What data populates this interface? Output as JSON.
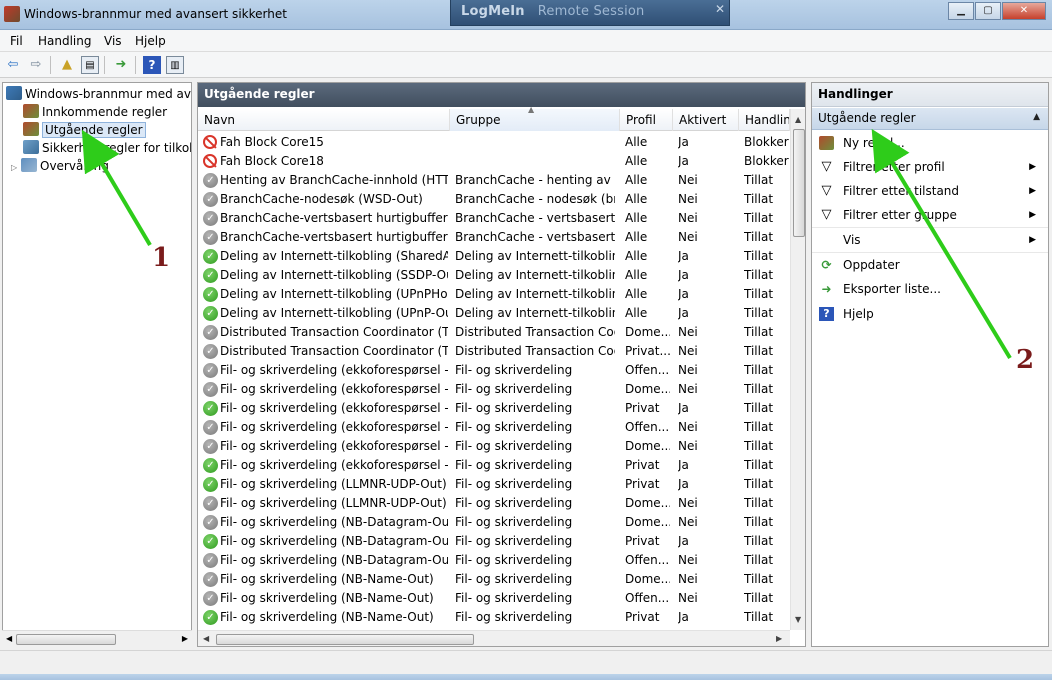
{
  "window": {
    "title": "Windows-brannmur med avansert sikkerhet",
    "remote_label_bold": "LogMeIn",
    "remote_label": "Remote Session",
    "remote_close": "✕",
    "minimize": "▁",
    "maximize": "▢",
    "close": "✕"
  },
  "menu": [
    "Fil",
    "Handling",
    "Vis",
    "Hjelp"
  ],
  "toolbar_icons": [
    "back-arrow-icon",
    "forward-arrow-icon",
    "up-folder-icon",
    "show-hide-tree-icon",
    "export-list-icon",
    "help-icon",
    "show-hide-action-pane-icon"
  ],
  "tree": {
    "root": "Windows-brannmur med avansert sikkerhet",
    "items": [
      {
        "label": "Innkommende regler"
      },
      {
        "label": "Utgående regler"
      },
      {
        "label": "Sikkerhetsregler for tilkoblinger"
      },
      {
        "label": "Overvåking"
      }
    ]
  },
  "center": {
    "title": "Utgående regler",
    "columns": [
      "Navn",
      "Gruppe",
      "Profil",
      "Aktivert",
      "Handling"
    ],
    "rows": [
      {
        "icon": "block",
        "name": "Fah Block Core15",
        "group": "",
        "profile": "Alle",
        "active": "Ja",
        "action": "Blokker"
      },
      {
        "icon": "block",
        "name": "Fah Block Core18",
        "group": "",
        "profile": "Alle",
        "active": "Ja",
        "action": "Blokker"
      },
      {
        "icon": "disabled",
        "name": "Henting av BranchCache-innhold (HTTP...",
        "group": "BranchCache - henting av i...",
        "profile": "Alle",
        "active": "Nei",
        "action": "Tillat"
      },
      {
        "icon": "disabled",
        "name": "BranchCache-nodesøk (WSD-Out)",
        "group": "BranchCache - nodesøk (br...",
        "profile": "Alle",
        "active": "Nei",
        "action": "Tillat"
      },
      {
        "icon": "disabled",
        "name": "BranchCache-vertsbasert hurtigbufferklie...",
        "group": "BranchCache - vertsbasert h...",
        "profile": "Alle",
        "active": "Nei",
        "action": "Tillat"
      },
      {
        "icon": "disabled",
        "name": "BranchCache-vertsbasert hurtigbufferser...",
        "group": "BranchCache - vertsbasert h...",
        "profile": "Alle",
        "active": "Nei",
        "action": "Tillat"
      },
      {
        "icon": "allow",
        "name": "Deling av Internett-tilkobling (SharedAcc...",
        "group": "Deling av Internett-tilkobling",
        "profile": "Alle",
        "active": "Ja",
        "action": "Tillat"
      },
      {
        "icon": "allow",
        "name": "Deling av Internett-tilkobling (SSDP-Out)",
        "group": "Deling av Internett-tilkobling",
        "profile": "Alle",
        "active": "Ja",
        "action": "Tillat"
      },
      {
        "icon": "allow",
        "name": "Deling av Internett-tilkobling (UPnPHost...",
        "group": "Deling av Internett-tilkobling",
        "profile": "Alle",
        "active": "Ja",
        "action": "Tillat"
      },
      {
        "icon": "allow",
        "name": "Deling av Internett-tilkobling (UPnP-Out)",
        "group": "Deling av Internett-tilkobling",
        "profile": "Alle",
        "active": "Ja",
        "action": "Tillat"
      },
      {
        "icon": "disabled",
        "name": "Distributed Transaction Coordinator (TC...",
        "group": "Distributed Transaction Coo...",
        "profile": "Dome...",
        "active": "Nei",
        "action": "Tillat"
      },
      {
        "icon": "disabled",
        "name": "Distributed Transaction Coordinator (TC...",
        "group": "Distributed Transaction Coo...",
        "profile": "Privat...",
        "active": "Nei",
        "action": "Tillat"
      },
      {
        "icon": "disabled",
        "name": "Fil- og skriverdeling (ekkoforespørsel - IC...",
        "group": "Fil- og skriverdeling",
        "profile": "Offen...",
        "active": "Nei",
        "action": "Tillat"
      },
      {
        "icon": "disabled",
        "name": "Fil- og skriverdeling (ekkoforespørsel - IC...",
        "group": "Fil- og skriverdeling",
        "profile": "Dome...",
        "active": "Nei",
        "action": "Tillat"
      },
      {
        "icon": "allow",
        "name": "Fil- og skriverdeling (ekkoforespørsel - IC...",
        "group": "Fil- og skriverdeling",
        "profile": "Privat",
        "active": "Ja",
        "action": "Tillat"
      },
      {
        "icon": "disabled",
        "name": "Fil- og skriverdeling (ekkoforespørsel - IC...",
        "group": "Fil- og skriverdeling",
        "profile": "Offen...",
        "active": "Nei",
        "action": "Tillat"
      },
      {
        "icon": "disabled",
        "name": "Fil- og skriverdeling (ekkoforespørsel - IC...",
        "group": "Fil- og skriverdeling",
        "profile": "Dome...",
        "active": "Nei",
        "action": "Tillat"
      },
      {
        "icon": "allow",
        "name": "Fil- og skriverdeling (ekkoforespørsel - IC...",
        "group": "Fil- og skriverdeling",
        "profile": "Privat",
        "active": "Ja",
        "action": "Tillat"
      },
      {
        "icon": "allow",
        "name": "Fil- og skriverdeling (LLMNR-UDP-Out)",
        "group": "Fil- og skriverdeling",
        "profile": "Privat",
        "active": "Ja",
        "action": "Tillat"
      },
      {
        "icon": "disabled",
        "name": "Fil- og skriverdeling (LLMNR-UDP-Out)",
        "group": "Fil- og skriverdeling",
        "profile": "Dome...",
        "active": "Nei",
        "action": "Tillat"
      },
      {
        "icon": "disabled",
        "name": "Fil- og skriverdeling (NB-Datagram-Out)",
        "group": "Fil- og skriverdeling",
        "profile": "Dome...",
        "active": "Nei",
        "action": "Tillat"
      },
      {
        "icon": "allow",
        "name": "Fil- og skriverdeling (NB-Datagram-Out)",
        "group": "Fil- og skriverdeling",
        "profile": "Privat",
        "active": "Ja",
        "action": "Tillat"
      },
      {
        "icon": "disabled",
        "name": "Fil- og skriverdeling (NB-Datagram-Out)",
        "group": "Fil- og skriverdeling",
        "profile": "Offen...",
        "active": "Nei",
        "action": "Tillat"
      },
      {
        "icon": "disabled",
        "name": "Fil- og skriverdeling (NB-Name-Out)",
        "group": "Fil- og skriverdeling",
        "profile": "Dome...",
        "active": "Nei",
        "action": "Tillat"
      },
      {
        "icon": "disabled",
        "name": "Fil- og skriverdeling (NB-Name-Out)",
        "group": "Fil- og skriverdeling",
        "profile": "Offen...",
        "active": "Nei",
        "action": "Tillat"
      },
      {
        "icon": "allow",
        "name": "Fil- og skriverdeling (NB-Name-Out)",
        "group": "Fil- og skriverdeling",
        "profile": "Privat",
        "active": "Ja",
        "action": "Tillat"
      }
    ]
  },
  "actions": {
    "title": "Handlinger",
    "section": "Utgående regler",
    "items": [
      {
        "label": "Ny regel...",
        "icon": "new-rule-icon",
        "submenu": false
      },
      {
        "label": "Filtrer etter profil",
        "icon": "filter-icon",
        "submenu": true
      },
      {
        "label": "Filtrer etter tilstand",
        "icon": "filter-icon",
        "submenu": true
      },
      {
        "label": "Filtrer etter gruppe",
        "icon": "filter-icon",
        "submenu": true
      },
      {
        "label": "Vis",
        "icon": "",
        "submenu": true
      },
      {
        "label": "Oppdater",
        "icon": "refresh-icon",
        "submenu": false
      },
      {
        "label": "Eksporter liste...",
        "icon": "export-list-icon",
        "submenu": false
      },
      {
        "label": "Hjelp",
        "icon": "help-icon",
        "submenu": false
      }
    ]
  },
  "annotations": [
    {
      "label": "1"
    },
    {
      "label": "2"
    }
  ],
  "colors": {
    "arrow": "#2ecc1a",
    "annotation_text": "#7a1b1b",
    "header_dark": "#414e5e"
  }
}
